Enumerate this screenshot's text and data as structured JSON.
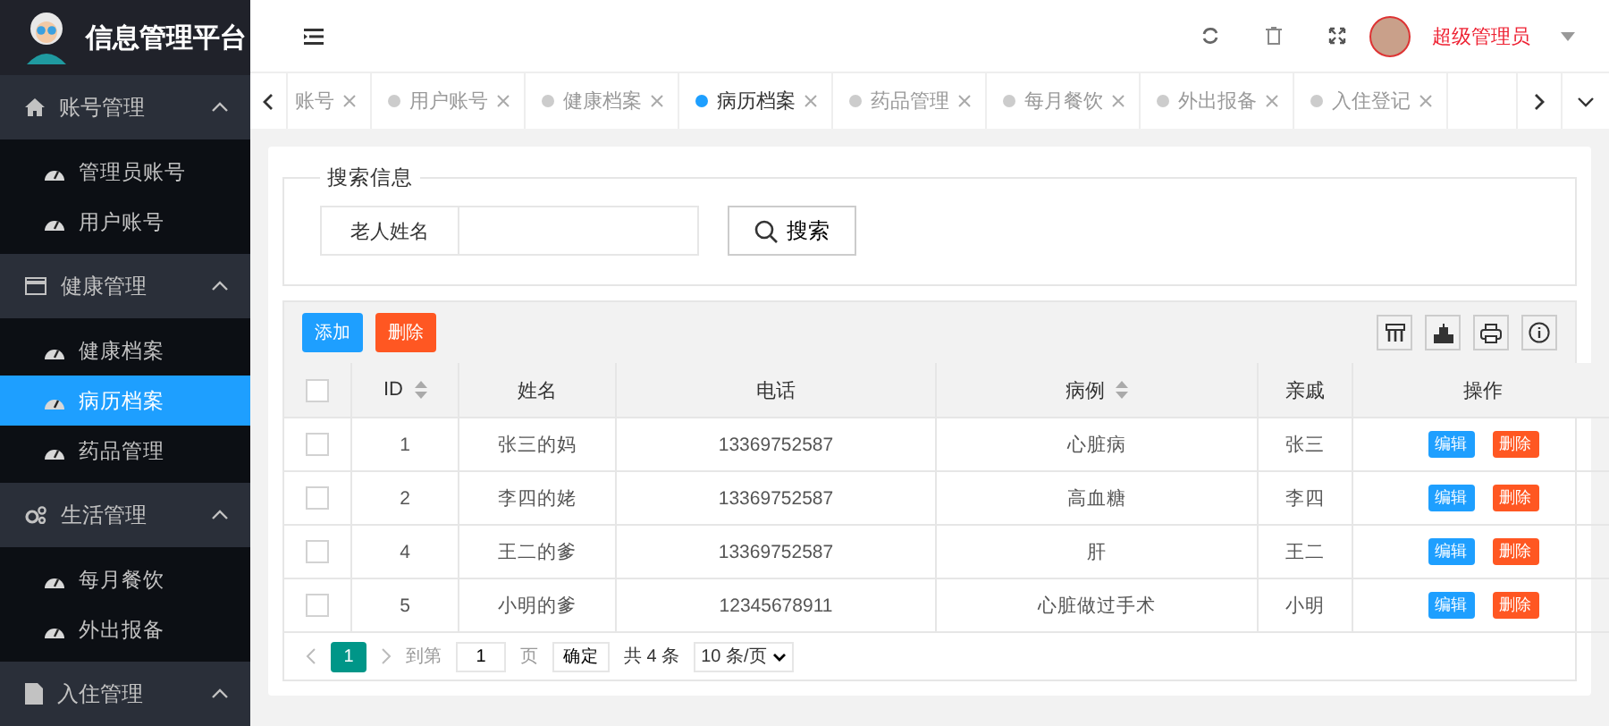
{
  "app": {
    "title": "信息管理平台"
  },
  "sidebar": {
    "groups": [
      {
        "label": "账号管理",
        "expanded": true,
        "items": [
          {
            "label": "管理员账号",
            "selected": false
          },
          {
            "label": "用户账号",
            "selected": false
          }
        ]
      },
      {
        "label": "健康管理",
        "expanded": true,
        "items": [
          {
            "label": "健康档案",
            "selected": false
          },
          {
            "label": "病历档案",
            "selected": true
          },
          {
            "label": "药品管理",
            "selected": false
          }
        ]
      },
      {
        "label": "生活管理",
        "expanded": true,
        "items": [
          {
            "label": "每月餐饮",
            "selected": false
          },
          {
            "label": "外出报备",
            "selected": false
          }
        ]
      },
      {
        "label": "入住管理",
        "expanded": true
      }
    ]
  },
  "header": {
    "user": "超级管理员"
  },
  "tabs": [
    {
      "label": "账号",
      "selected": false,
      "kind": "cut"
    },
    {
      "label": "用户账号",
      "selected": false,
      "kind": "full"
    },
    {
      "label": "健康档案",
      "selected": false,
      "kind": "full"
    },
    {
      "label": "病历档案",
      "selected": true,
      "kind": "full"
    },
    {
      "label": "药品管理",
      "selected": false,
      "kind": "full"
    },
    {
      "label": "每月餐饮",
      "selected": false,
      "kind": "full"
    },
    {
      "label": "外出报备",
      "selected": false,
      "kind": "full"
    },
    {
      "label": "入住登记",
      "selected": false,
      "kind": "full"
    }
  ],
  "search": {
    "legend": "搜索信息",
    "field_label": "老人姓名",
    "button": "搜索"
  },
  "toolbar": {
    "add": "添加",
    "delete": "删除"
  },
  "table": {
    "select_all_checked": false,
    "columns": [
      {
        "label": "ID",
        "sortable": true
      },
      {
        "label": "姓名",
        "sortable": false
      },
      {
        "label": "电话",
        "sortable": false
      },
      {
        "label": "病例",
        "sortable": true
      },
      {
        "label": "亲戚",
        "sortable": false
      },
      {
        "label": "操作",
        "sortable": false
      }
    ],
    "rows": [
      {
        "checked": false,
        "cells": [
          "1",
          "张三的妈",
          "13369752587",
          "心脏病",
          "张三"
        ],
        "actions": [
          "编辑",
          "删除"
        ]
      },
      {
        "checked": false,
        "cells": [
          "2",
          "李四的姥",
          "13369752587",
          "高血糖",
          "李四"
        ],
        "actions": [
          "编辑",
          "删除"
        ]
      },
      {
        "checked": false,
        "cells": [
          "4",
          "王二的爹",
          "13369752587",
          "肝",
          "王二"
        ],
        "actions": [
          "编辑",
          "删除"
        ]
      },
      {
        "checked": false,
        "cells": [
          "5",
          "小明的爹",
          "12345678911",
          "心脏做过手术",
          "小明"
        ],
        "actions": [
          "编辑",
          "删除"
        ]
      }
    ]
  },
  "pagination": {
    "current": "1",
    "goto_label": "到第",
    "goto_value": "1",
    "page_label": "页",
    "confirm": "确定",
    "total": "共 4 条",
    "page_size": "10 条/页"
  }
}
